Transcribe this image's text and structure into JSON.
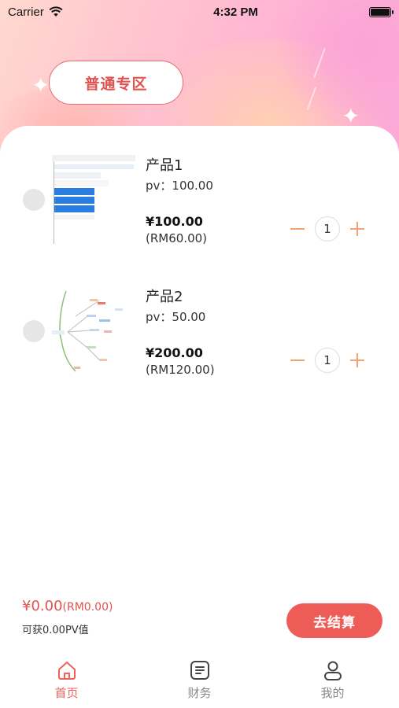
{
  "status_bar": {
    "carrier": "Carrier",
    "time": "4:32 PM"
  },
  "zone_button": {
    "label": "普通专区"
  },
  "products": [
    {
      "name": "产品1",
      "pv": "pv：100.00",
      "price": "¥100.00",
      "rm": "(RM60.00)",
      "quantity": "1"
    },
    {
      "name": "产品2",
      "pv": "pv：50.00",
      "price": "¥200.00",
      "rm": "(RM120.00)",
      "quantity": "1"
    }
  ],
  "summary": {
    "amount": "¥0.00",
    "amount_rm": "(RM0.00)",
    "pv_text": "可获0.00PV值",
    "checkout_label": "去结算"
  },
  "tabs": [
    {
      "label": "首页",
      "icon": "home-icon",
      "active": true
    },
    {
      "label": "财务",
      "icon": "ledger-icon",
      "active": false
    },
    {
      "label": "我的",
      "icon": "user-icon",
      "active": false
    }
  ],
  "colors": {
    "accent": "#ee5c57",
    "stepper": "#f0a474",
    "tab_active": "#ef6356"
  }
}
